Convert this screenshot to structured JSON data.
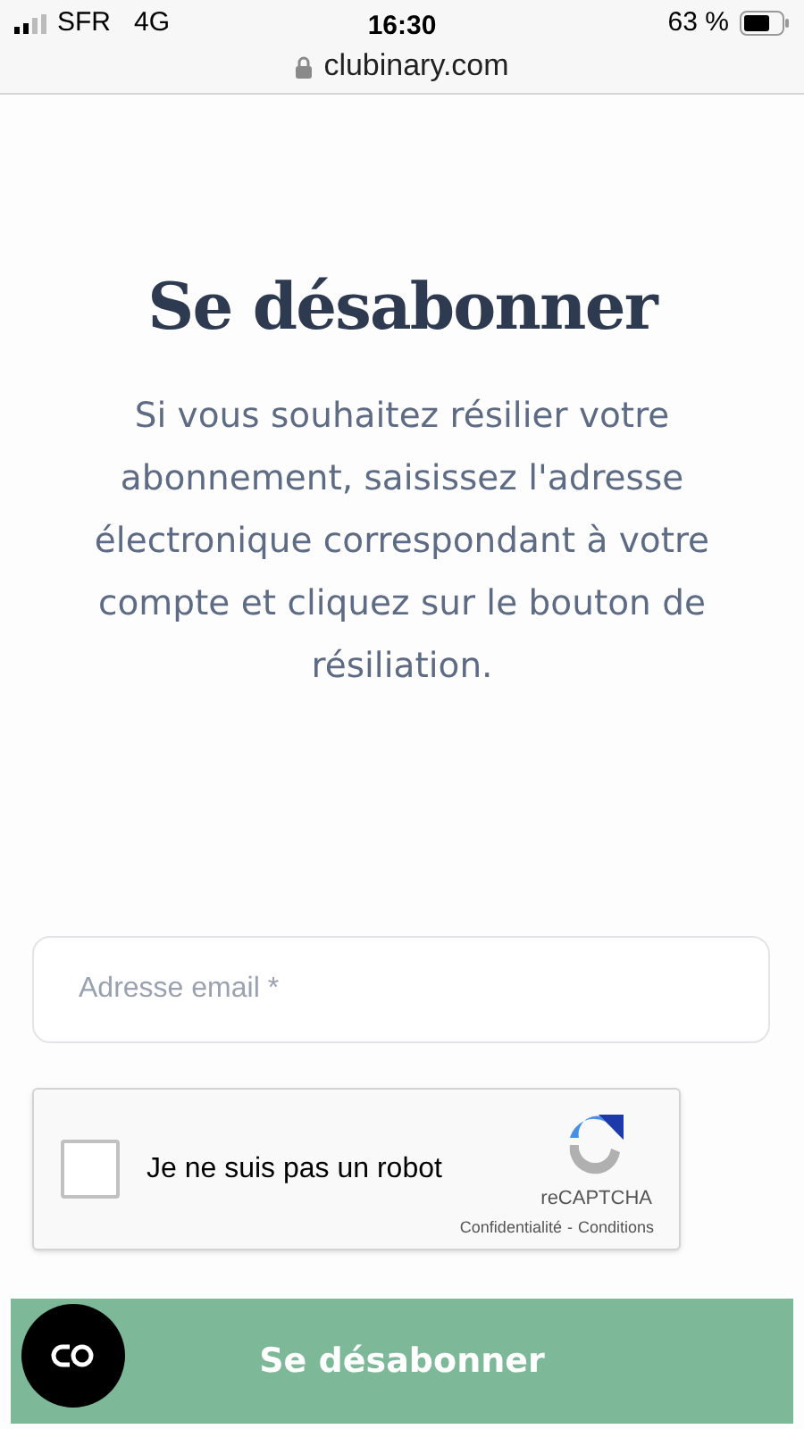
{
  "status_bar": {
    "carrier": "SFR",
    "network": "4G",
    "time": "16:30",
    "battery": "63 %"
  },
  "address_bar": {
    "url": "clubinary.com"
  },
  "title": "Se désabonner",
  "description": "Si vous souhaitez résilier votre abonnement, saisissez l'adresse électronique correspondant à votre compte et cliquez sur le bouton de résiliation.",
  "email_field": {
    "placeholder": "Adresse email *"
  },
  "captcha": {
    "label": "Je ne suis pas un robot",
    "checked": false,
    "brand": "reCAPTCHA",
    "privacy": "Confidentialité",
    "separator": "-",
    "terms": "Conditions"
  },
  "submit_button": "Se désabonner"
}
